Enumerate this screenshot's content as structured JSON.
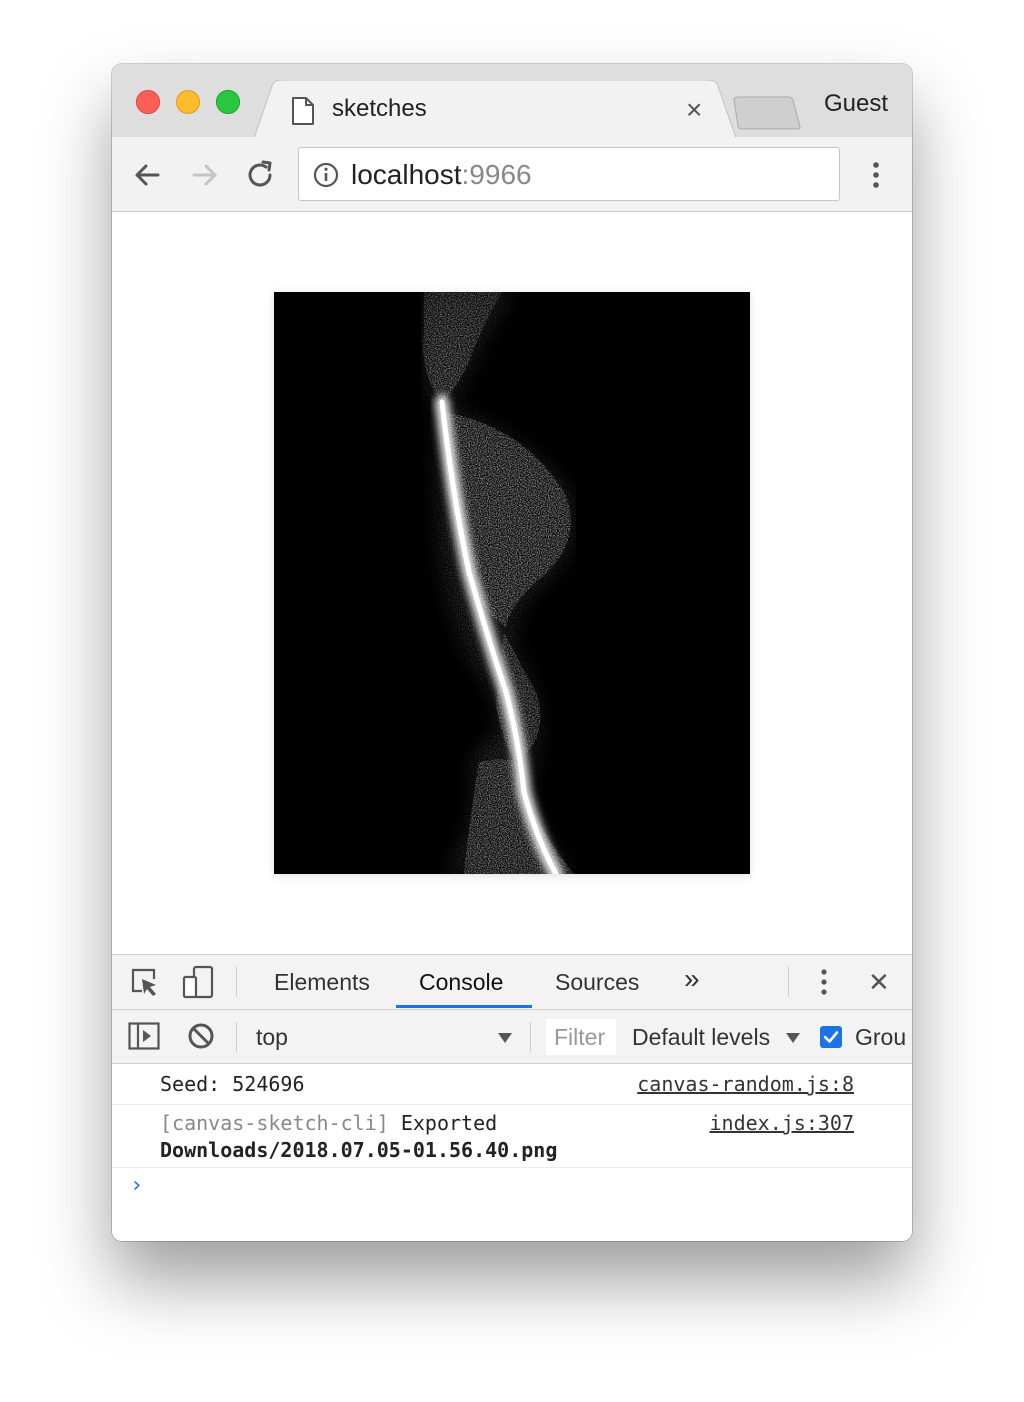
{
  "window": {
    "tab": {
      "title": "sketches",
      "close_glyph": "×"
    },
    "profile": "Guest"
  },
  "toolbar": {
    "url_host": "localhost",
    "url_port": ":9966"
  },
  "page": {
    "artwork": "canvas-sketch-render"
  },
  "devtools": {
    "tabs": [
      {
        "label": "Elements",
        "active": false
      },
      {
        "label": "Console",
        "active": true
      },
      {
        "label": "Sources",
        "active": false
      }
    ],
    "more_tabs_glyph": "»",
    "close_glyph": "✕",
    "context": "top",
    "filter_placeholder": "Filter",
    "levels": "Default levels",
    "group_label": "Grou",
    "group_checked": true,
    "logs": [
      {
        "text": "Seed: 524696",
        "source": "canvas-random.js:8"
      },
      {
        "prefix": "[canvas-sketch-cli]",
        "text": " Exported",
        "detail": "Downloads/2018.07.05-01.56.40.png",
        "source": "index.js:307"
      }
    ],
    "prompt": "›"
  },
  "colors": {
    "accent": "#1a73e8",
    "traffic_close": "#fc5f57",
    "traffic_min": "#fdbc2e",
    "traffic_max": "#28c840"
  }
}
